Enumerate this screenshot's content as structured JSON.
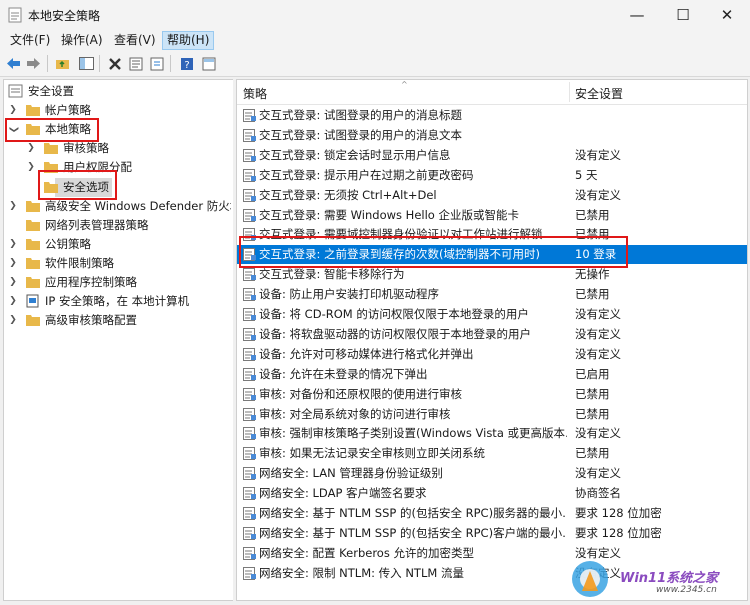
{
  "window": {
    "title": "本地安全策略",
    "min_glyph": "—",
    "max_glyph": "☐",
    "close_glyph": "✕"
  },
  "menu": [
    "文件(F)",
    "操作(A)",
    "查看(V)",
    "帮助(H)"
  ],
  "tree": {
    "root": "安全设置",
    "items": [
      {
        "label": "帐户策略"
      },
      {
        "label": "本地策略"
      },
      {
        "label": "审核策略"
      },
      {
        "label": "用户权限分配"
      },
      {
        "label": "安全选项"
      },
      {
        "label": "高级安全 Windows Defender 防火墙"
      },
      {
        "label": "网络列表管理器策略"
      },
      {
        "label": "公钥策略"
      },
      {
        "label": "软件限制策略"
      },
      {
        "label": "应用程序控制策略"
      },
      {
        "label": "IP 安全策略，在 本地计算机"
      },
      {
        "label": "高级审核策略配置"
      }
    ]
  },
  "columns": {
    "policy": "策略",
    "setting": "安全设置"
  },
  "rows": [
    {
      "name": "交互式登录: 试图登录的用户的消息标题",
      "value": ""
    },
    {
      "name": "交互式登录: 试图登录的用户的消息文本",
      "value": ""
    },
    {
      "name": "交互式登录: 锁定会话时显示用户信息",
      "value": "没有定义"
    },
    {
      "name": "交互式登录: 提示用户在过期之前更改密码",
      "value": "5 天"
    },
    {
      "name": "交互式登录: 无须按 Ctrl+Alt+Del",
      "value": "没有定义"
    },
    {
      "name": "交互式登录: 需要 Windows Hello 企业版或智能卡",
      "value": "已禁用"
    },
    {
      "name": "交互式登录: 需要域控制器身份验证以对工作站进行解锁",
      "value": "已禁用"
    },
    {
      "name": "交互式登录: 之前登录到缓存的次数(域控制器不可用时)",
      "value": "10 登录"
    },
    {
      "name": "交互式登录: 智能卡移除行为",
      "value": "无操作"
    },
    {
      "name": "设备: 防止用户安装打印机驱动程序",
      "value": "已禁用"
    },
    {
      "name": "设备: 将 CD-ROM 的访问权限仅限于本地登录的用户",
      "value": "没有定义"
    },
    {
      "name": "设备: 将软盘驱动器的访问权限仅限于本地登录的用户",
      "value": "没有定义"
    },
    {
      "name": "设备: 允许对可移动媒体进行格式化并弹出",
      "value": "没有定义"
    },
    {
      "name": "设备: 允许在未登录的情况下弹出",
      "value": "已启用"
    },
    {
      "name": "审核: 对备份和还原权限的使用进行审核",
      "value": "已禁用"
    },
    {
      "name": "审核: 对全局系统对象的访问进行审核",
      "value": "已禁用"
    },
    {
      "name": "审核: 强制审核策略子类别设置(Windows Vista 或更高版本…",
      "value": "没有定义"
    },
    {
      "name": "审核: 如果无法记录安全审核则立即关闭系统",
      "value": "已禁用"
    },
    {
      "name": "网络安全: LAN 管理器身份验证级别",
      "value": "没有定义"
    },
    {
      "name": "网络安全: LDAP 客户端签名要求",
      "value": "协商签名"
    },
    {
      "name": "网络安全: 基于 NTLM SSP 的(包括安全 RPC)服务器的最小…",
      "value": "要求 128 位加密"
    },
    {
      "name": "网络安全: 基于 NTLM SSP 的(包括安全 RPC)客户端的最小…",
      "value": "要求 128 位加密"
    },
    {
      "name": "网络安全: 配置 Kerberos 允许的加密类型",
      "value": "没有定义"
    },
    {
      "name": "网络安全: 限制 NTLM: 传入 NTLM 流量",
      "value": "没有定义"
    }
  ],
  "selected_row_index": 7,
  "watermark": {
    "text": "Win11系统之家",
    "url": "www.2345.cn"
  },
  "colors": {
    "selection": "#0078d7",
    "highlight_box": "#e01818",
    "folder": "#e8b84a"
  }
}
